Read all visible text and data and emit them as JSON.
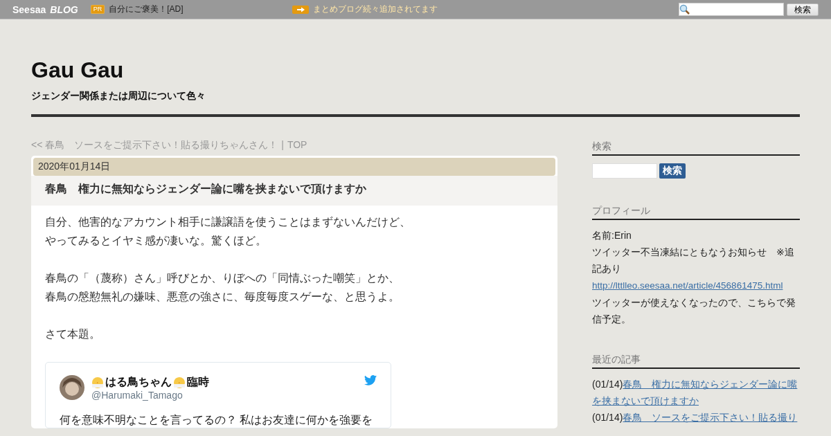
{
  "topbar": {
    "logo": "Seesaa",
    "logo_suffix": "BLOG",
    "pr_badge": "PR",
    "ad_text": "自分にご褒美！[AD]",
    "notice": "まとめブログ続々追加されてます",
    "search_button": "検索"
  },
  "blog": {
    "title": "Gau Gau",
    "subtitle": "ジェンダー関係または周辺について色々"
  },
  "nav": {
    "prev": "<< 春鳥　ソースをご提示下さい！貼る撮りちゃんさん！",
    "separator": "|",
    "top": "TOP"
  },
  "article": {
    "date": "2020年01月14日",
    "title": "春鳥　権力に無知ならジェンダー論に嘴を挟まないで頂けますか",
    "paragraphs": [
      [
        "自分、他害的なアカウント相手に謙譲語を使うことはまずないんだけど、",
        "やってみるとイヤミ感が凄いな。驚くほど。"
      ],
      [
        "春鳥の「（蔑称）さん」呼びとか、りぼへの「同情ぶった嘲笑」とか、",
        "春鳥の慇懃無礼の嫌味、悪意の強さに、毎度毎度スゲーな、と思うよ。"
      ],
      [
        "さて本題。"
      ]
    ],
    "tweet": {
      "name_before": "はる鳥ちゃん",
      "name_after": "臨時",
      "handle": "@Harumaki_Tamago",
      "text": "何を意味不明なことを言ってるの？ 私はお友達に何かを強要を"
    }
  },
  "sidebar": {
    "search": {
      "heading": "検索",
      "button": "検索"
    },
    "profile": {
      "heading": "プロフィール",
      "lines": [
        {
          "kind": "text",
          "text": "名前:Erin"
        },
        {
          "kind": "text",
          "text": "ツイッター不当凍結にともなうお知らせ　※追記あり"
        },
        {
          "kind": "link",
          "text": "http://lttlleo.seesaa.net/article/456861475.html"
        },
        {
          "kind": "text",
          "text": "ツイッターが使えなくなったので、こちらで発信予定。"
        }
      ]
    },
    "recent": {
      "heading": "最近の記事",
      "items": [
        {
          "date": "(01/14)",
          "title": "春鳥　権力に無知ならジェンダー論に嘴を挟まないで頂けますか"
        },
        {
          "date": "(01/14)",
          "title": "春鳥　ソースをご提示下さい！貼る撮り"
        }
      ]
    }
  }
}
